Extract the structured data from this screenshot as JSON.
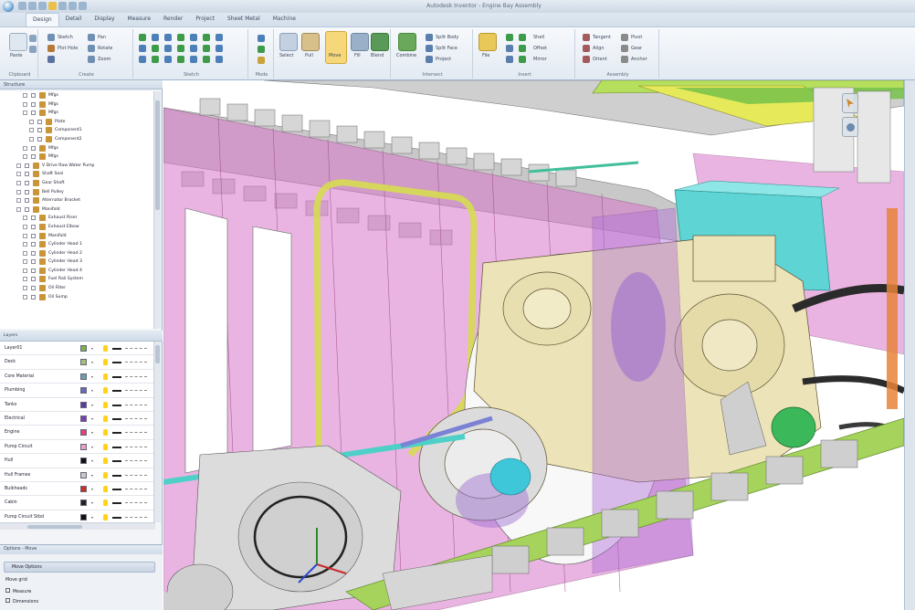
{
  "window": {
    "title": "Autodesk Inventor - Engine Bay Assembly"
  },
  "ribbon": {
    "tabs": [
      "Design",
      "Detail",
      "Display",
      "Measure",
      "Render",
      "Project",
      "Sheet Metal",
      "Machine"
    ],
    "active_tab": "Design",
    "groups": [
      {
        "label": "Clipboard",
        "items": [
          "Paste"
        ]
      },
      {
        "label": "Create",
        "items": [
          "Sketch",
          "Plot Hole",
          "Pan",
          "Rotate",
          "Zoom"
        ]
      },
      {
        "label": "Sketch",
        "items": []
      },
      {
        "label": "Mode",
        "items": []
      },
      {
        "label": "",
        "items": [
          "Select",
          "Pull",
          "Move",
          "Fill",
          "Blend"
        ]
      },
      {
        "label": "Intersect",
        "items": [
          "Combine",
          "Split Body",
          "Split Face",
          "Project"
        ]
      },
      {
        "label": "Insert",
        "items": [
          "File",
          "Shell",
          "Offset",
          "Mirror"
        ]
      },
      {
        "label": "Assembly",
        "items": [
          "Tangent",
          "Align",
          "Orient",
          "Pivot",
          "Gear",
          "Anchor"
        ]
      }
    ]
  },
  "structure": {
    "title": "Structure",
    "items": [
      {
        "label": "Mfgs",
        "depth": 3,
        "expanded": true
      },
      {
        "label": "Mfgs",
        "depth": 3,
        "expanded": false
      },
      {
        "label": "Mfgs",
        "depth": 3,
        "expanded": true
      },
      {
        "label": "Plate",
        "depth": 4,
        "expanded": false
      },
      {
        "label": "Component1",
        "depth": 4,
        "expanded": false
      },
      {
        "label": "Component2",
        "depth": 4,
        "expanded": false
      },
      {
        "label": "Mfgs",
        "depth": 3,
        "expanded": false
      },
      {
        "label": "Mfgs",
        "depth": 3,
        "expanded": false
      },
      {
        "label": "V Drive Raw Water Pump",
        "depth": 2,
        "expanded": false
      },
      {
        "label": "Shaft Seal",
        "depth": 2,
        "expanded": false
      },
      {
        "label": "Gear Shaft",
        "depth": 2,
        "expanded": false
      },
      {
        "label": "Bell Pulley",
        "depth": 2,
        "expanded": false
      },
      {
        "label": "Alternator Bracket",
        "depth": 2,
        "expanded": false
      },
      {
        "label": "Manifold",
        "depth": 2,
        "expanded": true
      },
      {
        "label": "Exhaust Riser",
        "depth": 3,
        "expanded": false
      },
      {
        "label": "Exhaust Elbow",
        "depth": 3,
        "expanded": false
      },
      {
        "label": "Manifold",
        "depth": 3,
        "expanded": false
      },
      {
        "label": "Cylinder Head 1",
        "depth": 3,
        "expanded": false
      },
      {
        "label": "Cylinder Head 2",
        "depth": 3,
        "expanded": false
      },
      {
        "label": "Cylinder Head 3",
        "depth": 3,
        "expanded": false
      },
      {
        "label": "Cylinder Head 4",
        "depth": 3,
        "expanded": false
      },
      {
        "label": "Fuel Rail System",
        "depth": 3,
        "expanded": false
      },
      {
        "label": "Oil Filter",
        "depth": 3,
        "expanded": false
      },
      {
        "label": "Oil Sump",
        "depth": 3,
        "expanded": false
      }
    ]
  },
  "layers": {
    "title": "Layers",
    "rows": [
      {
        "name": "Layer01",
        "color": "#7ab34a"
      },
      {
        "name": "Deck",
        "color": "#9fbf7a"
      },
      {
        "name": "Core Material",
        "color": "#6aa0a8"
      },
      {
        "name": "Plumbing",
        "color": "#6b68b8"
      },
      {
        "name": "Tanks",
        "color": "#5b3fa0"
      },
      {
        "name": "Electrical",
        "color": "#7a3fb0"
      },
      {
        "name": "Engine",
        "color": "#e4407a"
      },
      {
        "name": "Pump Circuit",
        "color": "#e8a0c0"
      },
      {
        "name": "Hull",
        "color": "#111111"
      },
      {
        "name": "Hull Frames",
        "color": "#c8c8c8"
      },
      {
        "name": "Bulkheads",
        "color": "#d02a2a"
      },
      {
        "name": "Cabin",
        "color": "#222222"
      },
      {
        "name": "Pump Circuit Stbd",
        "color": "#111111"
      },
      {
        "name": "Rudder",
        "color": "#e85a3a"
      }
    ]
  },
  "options": {
    "title": "Options - Move",
    "button": "Move Options",
    "items": [
      "Move grid",
      "Measure",
      "Dimensions"
    ]
  },
  "viewport": {
    "colors": {
      "frame": "#c9c9c9",
      "magenta": "#d877c9",
      "engine": "#ece3b8",
      "green": "#a6d35b",
      "cyan": "#5ed4d4",
      "yellow": "#e6ea5a",
      "purple": "#9a6ad0"
    }
  }
}
